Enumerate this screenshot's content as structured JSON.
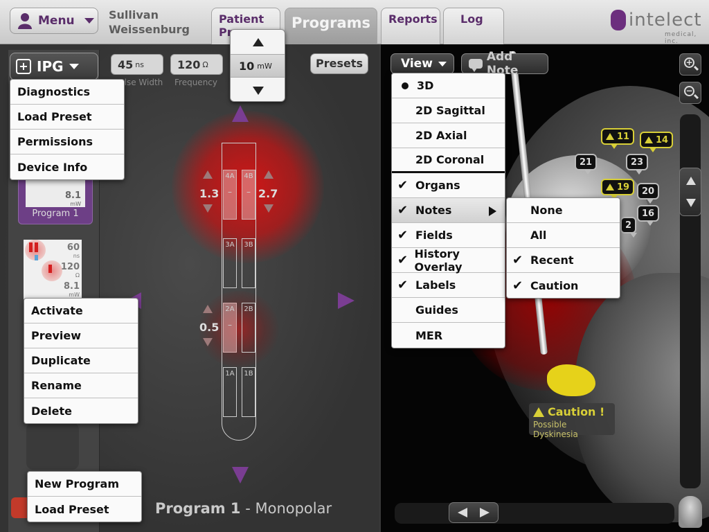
{
  "header": {
    "menu_label": "Menu",
    "patient_first": "Sullivan",
    "patient_last": "Weissenburg",
    "tabs": [
      {
        "label": "Patient Pr"
      },
      {
        "label": "Programs"
      },
      {
        "label": "Reports"
      },
      {
        "label": "Log"
      }
    ],
    "logo_text": "intelect",
    "logo_sub": "medical, inc."
  },
  "ipg": {
    "label": "IPG",
    "menu": [
      "Diagnostics",
      "Load Preset",
      "Permissions",
      "Device Info"
    ]
  },
  "params": {
    "pulse_width": {
      "value": "45",
      "unit": "ns",
      "label": "Pulse Width"
    },
    "frequency": {
      "value": "120",
      "unit": "Ω",
      "label": "Frequency"
    },
    "amplitude": {
      "value": "10",
      "unit": "mW"
    },
    "presets_label": "Presets"
  },
  "lead": {
    "contacts": [
      "4A",
      "4B",
      "3A",
      "3B",
      "2A",
      "2B",
      "1A",
      "1B"
    ],
    "active_dash": "–",
    "amp_4a": "1.3",
    "amp_4b": "2.7",
    "amp_2a": "0.5"
  },
  "programs": {
    "card1": {
      "name": "Program 1",
      "mw": "8.1",
      "mw_unit": "mW"
    },
    "card2": {
      "ns": "60",
      "ns_unit": "ns",
      "ohm": "120",
      "ohm_unit": "Ω",
      "mw": "8.1",
      "mw_unit": "mW"
    },
    "context_menu": [
      "Activate",
      "Preview",
      "Duplicate",
      "Rename",
      "Delete"
    ],
    "bottom_menu": [
      "New Program",
      "Load Preset"
    ],
    "title_name": "Program 1",
    "title_mode": " - Monopolar"
  },
  "view": {
    "label": "View",
    "add_note_label": "Add Note",
    "menu": [
      {
        "label": "3D",
        "mark": "dot"
      },
      {
        "label": "2D Sagittal",
        "mark": "none"
      },
      {
        "label": "2D Axial",
        "mark": "none"
      },
      {
        "label": "2D Coronal",
        "mark": "none"
      },
      {
        "label": "Organs",
        "mark": "check"
      },
      {
        "label": "Notes",
        "mark": "check"
      },
      {
        "label": "Fields",
        "mark": "check"
      },
      {
        "label": "History Overlay",
        "mark": "check"
      },
      {
        "label": "Labels",
        "mark": "check"
      },
      {
        "label": "Guides",
        "mark": "none"
      },
      {
        "label": "MER",
        "mark": "none"
      }
    ],
    "notes_submenu": [
      {
        "label": "None",
        "mark": "none"
      },
      {
        "label": "All",
        "mark": "none"
      },
      {
        "label": "Recent",
        "mark": "check"
      },
      {
        "label": "Caution",
        "mark": "check"
      }
    ]
  },
  "markers": [
    {
      "label": "11",
      "warn": true
    },
    {
      "label": "14",
      "warn": true
    },
    {
      "label": "21",
      "warn": false
    },
    {
      "label": "23",
      "warn": false
    },
    {
      "label": "19",
      "warn": true
    },
    {
      "label": "20",
      "warn": false
    },
    {
      "label": "16",
      "warn": false
    },
    {
      "label": "2",
      "warn": false
    }
  ],
  "caution": {
    "title": "Caution !",
    "subtitle": "Possible Dyskinesia"
  },
  "icons": {
    "check": "✔",
    "colors": {
      "accent": "#5a2d6a",
      "caution": "#d8cf37",
      "field": "#c81414"
    }
  }
}
